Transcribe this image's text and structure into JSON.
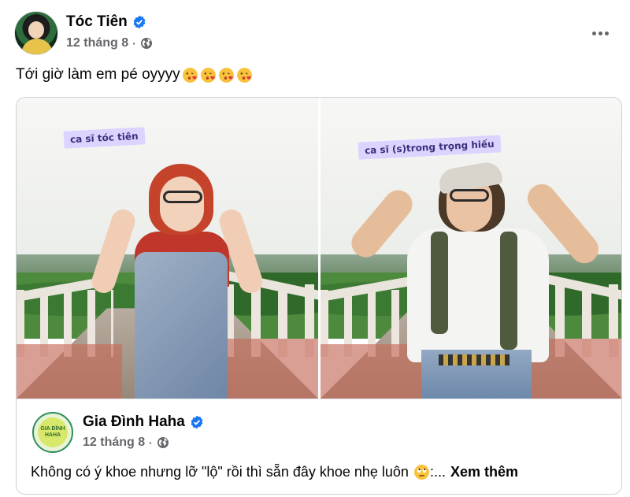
{
  "post": {
    "author": "Tóc Tiên",
    "verified": true,
    "date": "12 tháng 8",
    "separator": "·",
    "privacy_icon": "globe-icon",
    "more_icon": "more-options-icon",
    "caption": "Tới giờ làm em pé oyyyy",
    "caption_emojis": [
      "kissing-heart-emoji",
      "kissing-heart-emoji",
      "kissing-heart-emoji",
      "kissing-heart-emoji"
    ]
  },
  "shared": {
    "photos": [
      {
        "tag": "ca sĩ tóc tiên"
      },
      {
        "tag": "ca sĩ (s)trong trọng hiếu"
      }
    ],
    "page_name": "Gia Đình Haha",
    "page_avatar_text": "GIA ĐÌNH HAHA",
    "verified": true,
    "date": "12 tháng 8",
    "separator": "·",
    "privacy_icon": "globe-icon",
    "text": "Không có ý khoe nhưng lỡ \"lộ\" rồi thì sẵn đây khoe nhẹ luôn",
    "text_emoji": "rolling-eyes-emoji",
    "ellipsis": ":...",
    "see_more": "Xem thêm"
  },
  "colors": {
    "verified_blue": "#1877f2",
    "meta_gray": "#65676b",
    "text_dark": "#050505",
    "tag_bg": "#ddd3ff"
  }
}
